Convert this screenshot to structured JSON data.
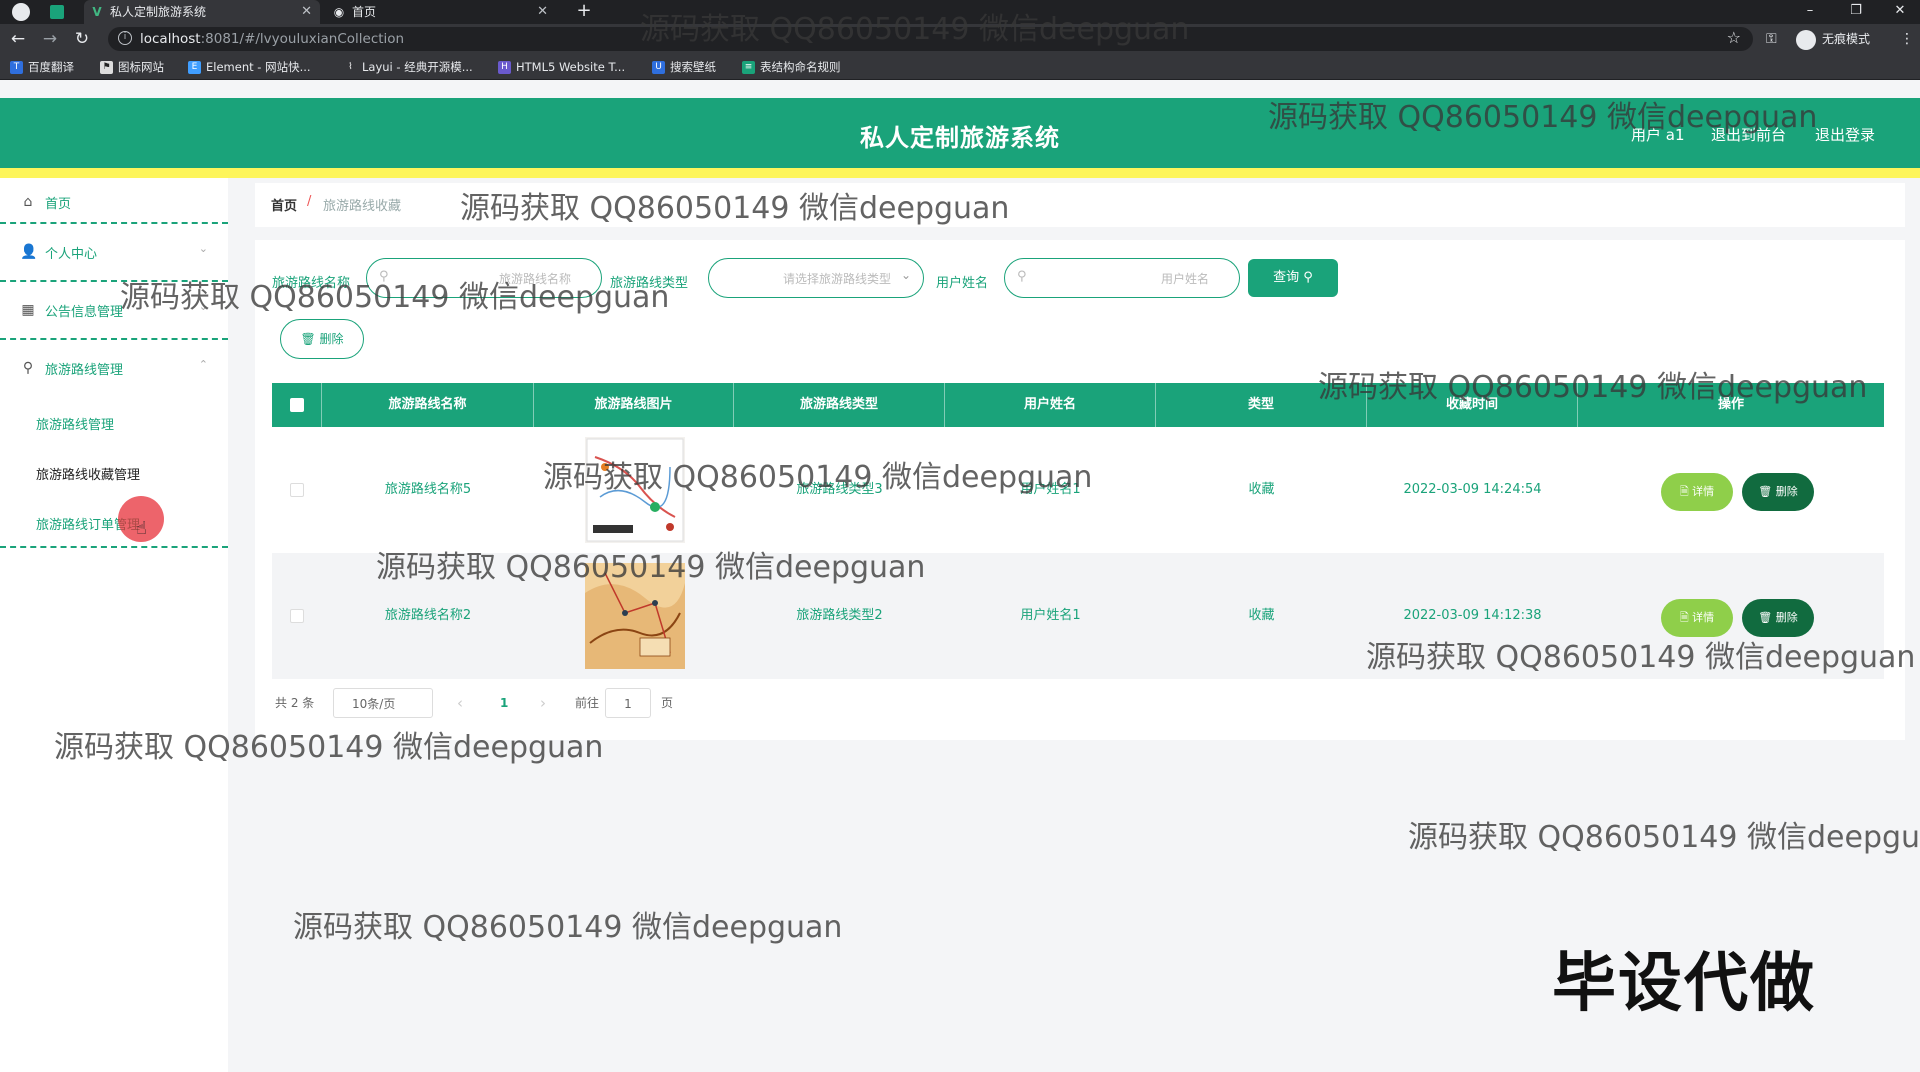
{
  "browser": {
    "tabs": [
      {
        "title": "私人定制旅游系统",
        "active": true
      },
      {
        "title": "首页",
        "active": false
      }
    ],
    "url_host": "localhost",
    "url_rest": ":8081/#/lvyouluxianCollection",
    "incognito_label": "无痕模式",
    "bookmarks": [
      "百度翻译",
      "图标网站",
      "Element - 网站快...",
      "Layui - 经典开源模...",
      "HTML5 Website T...",
      "搜索壁纸",
      "表结构命名规则"
    ]
  },
  "header": {
    "title": "私人定制旅游系统",
    "user": "用户 a1",
    "back_to_front": "退出到前台",
    "logout": "退出登录"
  },
  "sidebar": {
    "items": [
      {
        "label": "首页",
        "icon": "home-icon"
      },
      {
        "label": "个人中心",
        "icon": "user-icon"
      },
      {
        "label": "公告信息管理",
        "icon": "grid-icon"
      },
      {
        "label": "旅游路线管理",
        "icon": "route-icon"
      }
    ],
    "subitems": [
      "旅游路线管理",
      "旅游路线收藏管理",
      "旅游路线订单管理"
    ]
  },
  "breadcrumb": {
    "home": "首页",
    "sep": "/",
    "current": "旅游路线收藏"
  },
  "search": {
    "route_name_label": "旅游路线名称",
    "route_name_placeholder": "旅游路线名称",
    "route_type_label": "旅游路线类型",
    "route_type_placeholder": "请选择旅游路线类型",
    "user_name_label": "用户姓名",
    "user_name_placeholder": "用户姓名",
    "query_label": "查询 ⚲"
  },
  "batch_delete_label": "🗑 删除",
  "table": {
    "columns": [
      "旅游路线名称",
      "旅游路线图片",
      "旅游路线类型",
      "用户姓名",
      "类型",
      "收藏时间",
      "操作"
    ],
    "rows": [
      {
        "name": "旅游路线名称5",
        "type": "旅游路线类型3",
        "user": "用户姓名1",
        "kind": "收藏",
        "time": "2022-03-09 14:24:54"
      },
      {
        "name": "旅游路线名称2",
        "type": "旅游路线类型2",
        "user": "用户姓名1",
        "kind": "收藏",
        "time": "2022-03-09 14:12:38"
      }
    ],
    "detail_label": "🗎 详情",
    "delete_label": "🗑 删除"
  },
  "pagination": {
    "total": "共 2 条",
    "page_size": "10条/页",
    "prev": "‹",
    "current_page": "1",
    "next": "›",
    "goto_prefix": "前往",
    "goto_value": "1",
    "goto_suffix": "页"
  },
  "watermark": "源码获取 QQ86050149 微信deepguan",
  "overlay_text": "毕设代做",
  "colors": {
    "brand": "#1aa37a",
    "accent_strip": "#fdf55b",
    "detail_btn": "#8fcf4a",
    "delete_btn": "#116b3f"
  }
}
